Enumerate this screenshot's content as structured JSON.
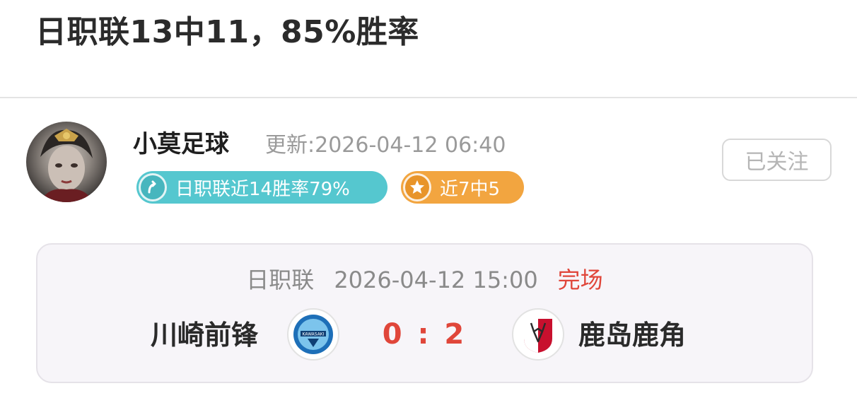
{
  "article": {
    "title": "日职联13中11，85%胜率"
  },
  "author": {
    "name": "小莫足球",
    "updated": "更新:2026-04-12 06:40",
    "follow_label": "已关注"
  },
  "badges": [
    {
      "label": "日职联近14胜率79%",
      "icon": "arrow-up-icon",
      "color": "#55c7cf"
    },
    {
      "label": "近7中5",
      "icon": "star-icon",
      "color": "#f2a540"
    }
  ],
  "match": {
    "league": "日职联",
    "datetime": "2026-04-12 15:00",
    "status": "完场",
    "home_team": "川崎前锋",
    "away_team": "鹿岛鹿角",
    "score": "0 : 2",
    "home_logo_text": "KAWASAKI",
    "home_logo_icon": "kawasaki-frontale-crest",
    "away_logo_icon": "kashima-antlers-crest",
    "status_color": "#e0463a"
  }
}
